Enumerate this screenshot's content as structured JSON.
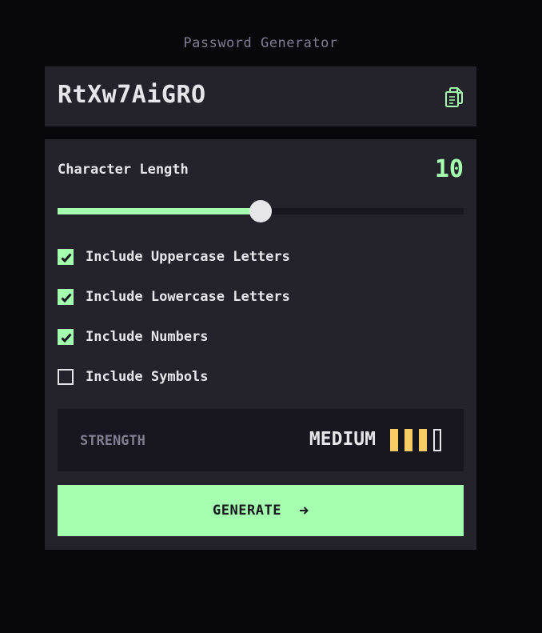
{
  "header": {
    "title": "Password Generator"
  },
  "password": {
    "value": "RtXw7AiGRO"
  },
  "length": {
    "label": "Character Length",
    "value": "10",
    "fraction": 0.5
  },
  "options": [
    {
      "label": "Include Uppercase Letters",
      "checked": true
    },
    {
      "label": "Include Lowercase Letters",
      "checked": true
    },
    {
      "label": "Include Numbers",
      "checked": true
    },
    {
      "label": "Include Symbols",
      "checked": false
    }
  ],
  "strength": {
    "label": "STRENGTH",
    "value": "MEDIUM",
    "filled_bars": 3,
    "total_bars": 4
  },
  "generate": {
    "label": "GENERATE"
  },
  "colors": {
    "accent": "#a4ffaf",
    "strength_medium": "#f8cd65",
    "background": "#08070b",
    "panel": "#24232c",
    "well": "#18171f",
    "text": "#e6e5ea",
    "muted": "#817d92"
  },
  "icons": {
    "copy": "copy-icon",
    "arrow": "arrow-right-icon",
    "check": "check-icon"
  }
}
